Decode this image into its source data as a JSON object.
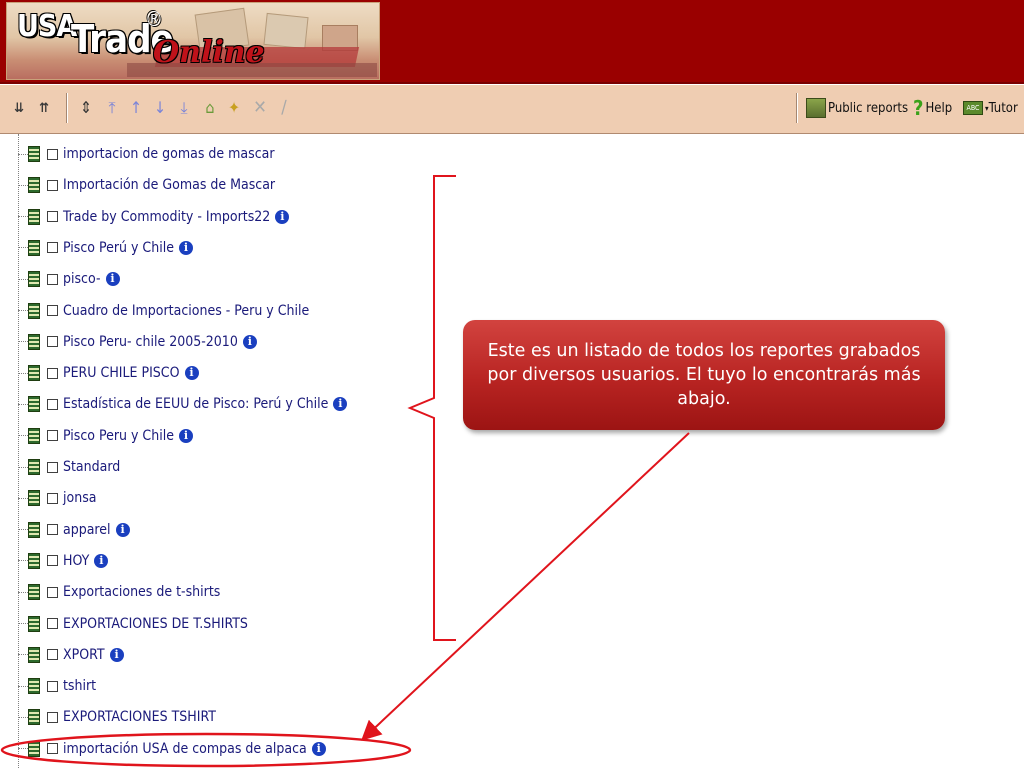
{
  "header": {
    "logo_usa": "USA",
    "logo_trade": "Trade",
    "logo_reg": "®",
    "logo_online": "Online"
  },
  "toolbar": {
    "public_reports": "Public reports",
    "help": "Help",
    "tutor": "Tutor",
    "abc_icon_text": "ABC"
  },
  "reports": [
    {
      "label": "importacion de gomas de mascar",
      "info": false
    },
    {
      "label": "Importación de Gomas de Mascar",
      "info": false
    },
    {
      "label": "Trade by Commodity - Imports22",
      "info": true
    },
    {
      "label": "Pisco Perú y Chile",
      "info": true
    },
    {
      "label": "pisco-",
      "info": true
    },
    {
      "label": "Cuadro de Importaciones - Peru y Chile",
      "info": false
    },
    {
      "label": "Pisco Peru- chile 2005-2010",
      "info": true
    },
    {
      "label": "PERU CHILE PISCO",
      "info": true
    },
    {
      "label": "Estadística de EEUU de Pisco: Perú y Chile",
      "info": true
    },
    {
      "label": "Pisco Peru y Chile",
      "info": true
    },
    {
      "label": "Standard",
      "info": false
    },
    {
      "label": "jonsa",
      "info": false
    },
    {
      "label": "apparel",
      "info": true
    },
    {
      "label": "HOY",
      "info": true
    },
    {
      "label": "Exportaciones de t-shirts",
      "info": false
    },
    {
      "label": "EXPORTACIONES DE T.SHIRTS",
      "info": false
    },
    {
      "label": "XPORT",
      "info": true
    },
    {
      "label": "tshirt",
      "info": false
    },
    {
      "label": "EXPORTACIONES TSHIRT",
      "info": false
    },
    {
      "label": "importación USA de compas de alpaca",
      "info": true
    }
  ],
  "info_glyph": "i",
  "callout": {
    "text": "Este es un listado de todos los reportes grabados por diversos usuarios. El tuyo lo encontrarás más abajo."
  },
  "colors": {
    "header_bg": "#9a0000",
    "toolbar_bg": "#efcdb2",
    "annotation_red": "#e0141c",
    "callout_bg": "#b82422",
    "link_text": "#1a1a7a"
  }
}
